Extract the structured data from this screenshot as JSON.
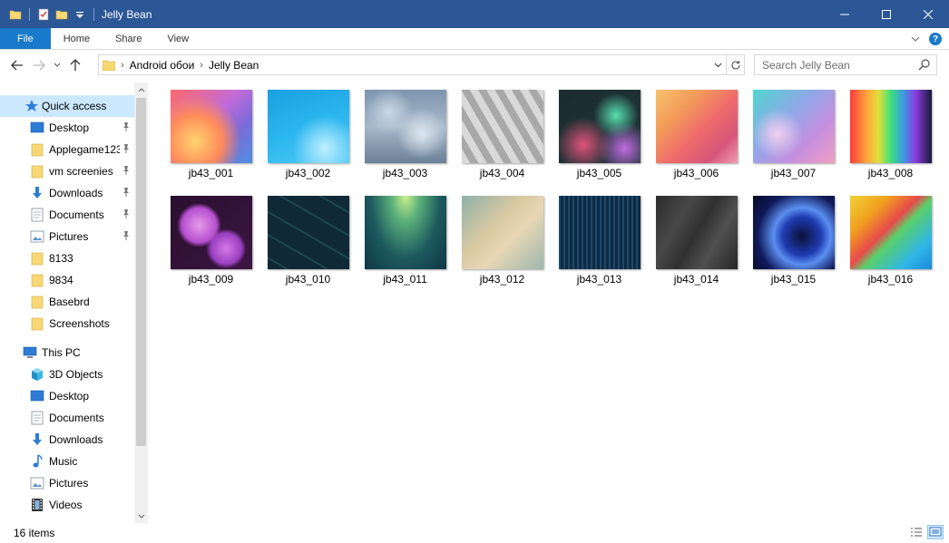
{
  "window": {
    "title": "Jelly Bean",
    "minimize_icon": "minimize-icon",
    "maximize_icon": "maximize-icon",
    "close_icon": "close-icon"
  },
  "colors": {
    "titlebar": "#2b5797",
    "file_tab": "#1979ca",
    "selection": "#cce8ff",
    "folder": "#f8d775"
  },
  "ribbon": {
    "file_label": "File",
    "tabs": [
      "Home",
      "Share",
      "View"
    ]
  },
  "address": {
    "crumbs": [
      "Android обои",
      "Jelly Bean"
    ]
  },
  "search": {
    "placeholder": "Search Jelly Bean"
  },
  "sidebar": {
    "quick_access": "Quick access",
    "quick_items": [
      {
        "label": "Desktop",
        "icon": "desktop-icon",
        "pinned": true
      },
      {
        "label": "Applegame123",
        "icon": "folder-icon",
        "pinned": true
      },
      {
        "label": "vm screenies",
        "icon": "folder-icon",
        "pinned": true
      },
      {
        "label": "Downloads",
        "icon": "download-icon",
        "pinned": true
      },
      {
        "label": "Documents",
        "icon": "documents-icon",
        "pinned": true
      },
      {
        "label": "Pictures",
        "icon": "pictures-icon",
        "pinned": true
      },
      {
        "label": "8133",
        "icon": "folder-icon",
        "pinned": false
      },
      {
        "label": "9834",
        "icon": "folder-icon",
        "pinned": false
      },
      {
        "label": "Basebrd",
        "icon": "folder-icon",
        "pinned": false
      },
      {
        "label": "Screenshots",
        "icon": "folder-icon",
        "pinned": false
      }
    ],
    "this_pc": "This PC",
    "pc_items": [
      {
        "label": "3D Objects",
        "icon": "3d-objects-icon"
      },
      {
        "label": "Desktop",
        "icon": "desktop-icon"
      },
      {
        "label": "Documents",
        "icon": "documents-icon"
      },
      {
        "label": "Downloads",
        "icon": "download-icon"
      },
      {
        "label": "Music",
        "icon": "music-icon"
      },
      {
        "label": "Pictures",
        "icon": "pictures-icon"
      },
      {
        "label": "Videos",
        "icon": "videos-icon"
      }
    ]
  },
  "files": [
    {
      "name": "jb43_001"
    },
    {
      "name": "jb43_002"
    },
    {
      "name": "jb43_003"
    },
    {
      "name": "jb43_004"
    },
    {
      "name": "jb43_005"
    },
    {
      "name": "jb43_006"
    },
    {
      "name": "jb43_007"
    },
    {
      "name": "jb43_008"
    },
    {
      "name": "jb43_009"
    },
    {
      "name": "jb43_010"
    },
    {
      "name": "jb43_011"
    },
    {
      "name": "jb43_012"
    },
    {
      "name": "jb43_013"
    },
    {
      "name": "jb43_014"
    },
    {
      "name": "jb43_015"
    },
    {
      "name": "jb43_016"
    }
  ],
  "status": {
    "item_count": "16 items"
  }
}
